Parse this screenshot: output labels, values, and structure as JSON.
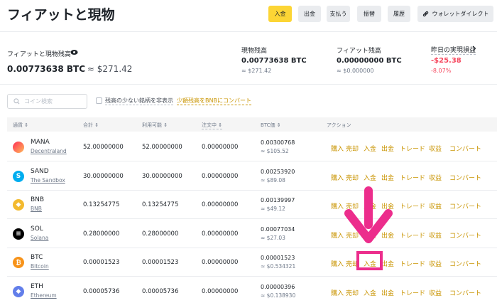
{
  "header": {
    "title": "フィアットと現物",
    "buttons": {
      "deposit": "入金",
      "withdraw": "出金",
      "pay": "支払う",
      "transfer": "振替",
      "history": "履歴",
      "wallet_direct": "ウォレットダイレクト"
    }
  },
  "balances": {
    "total_label": "フィアットと現物残高",
    "total_btc": "0.00773638 BTC",
    "total_usd": "≈ $271.42",
    "spot_label": "現物残高",
    "spot_btc": "0.00773638 BTC",
    "spot_usd": "≈ $271.42",
    "fiat_label": "フィアット残高",
    "fiat_btc": "0.00000000 BTC",
    "fiat_usd": "≈ $0.000000",
    "pnl_label": "昨日の実現損益",
    "pnl_value": "-$25.38",
    "pnl_pct": "-8.07%"
  },
  "filters": {
    "search_placeholder": "コイン検索",
    "hide_small_label": "残高の少ない銘柄を非表示",
    "convert_link": "少額残高をBNBにコンバート"
  },
  "table": {
    "headers": {
      "coin": "通貨",
      "total": "合計",
      "available": "利用可能",
      "in_order": "注文中",
      "btc_value": "BTC価",
      "action": "アクション"
    },
    "action_labels": {
      "buy": "購入",
      "sell": "売却",
      "deposit": "入金",
      "withdraw": "出金",
      "trade": "トレード",
      "earn": "収益",
      "convert": "コンバート"
    },
    "rows": [
      {
        "symbol": "MANA",
        "name": "Decentraland",
        "total": "52.00000000",
        "available": "52.00000000",
        "in_order": "0.00000000",
        "btc": "0.00300768",
        "usd": "≈ $105.52"
      },
      {
        "symbol": "SAND",
        "name": "The Sandbox",
        "total": "30.00000000",
        "available": "30.00000000",
        "in_order": "0.00000000",
        "btc": "0.00253920",
        "usd": "≈ $89.08"
      },
      {
        "symbol": "BNB",
        "name": "BNB",
        "total": "0.13254775",
        "available": "0.13254775",
        "in_order": "0.00000000",
        "btc": "0.00139997",
        "usd": "≈ $49.12"
      },
      {
        "symbol": "SOL",
        "name": "Solana",
        "total": "0.28000000",
        "available": "0.28000000",
        "in_order": "0.00000000",
        "btc": "0.00077034",
        "usd": "≈ $27.03"
      },
      {
        "symbol": "BTC",
        "name": "Bitcoin",
        "total": "0.00001523",
        "available": "0.00001523",
        "in_order": "0.00000000",
        "btc": "0.00001523",
        "usd": "≈ $0.534321"
      },
      {
        "symbol": "ETH",
        "name": "Ethereum",
        "total": "0.00005736",
        "available": "0.00005736",
        "in_order": "0.00000000",
        "btc": "0.00000396",
        "usd": "≈ $0.138930"
      }
    ]
  },
  "colors": {
    "accent": "#fcd535",
    "link": "#c99400",
    "negative": "#f6465d",
    "annotation": "#ec2d8c"
  }
}
